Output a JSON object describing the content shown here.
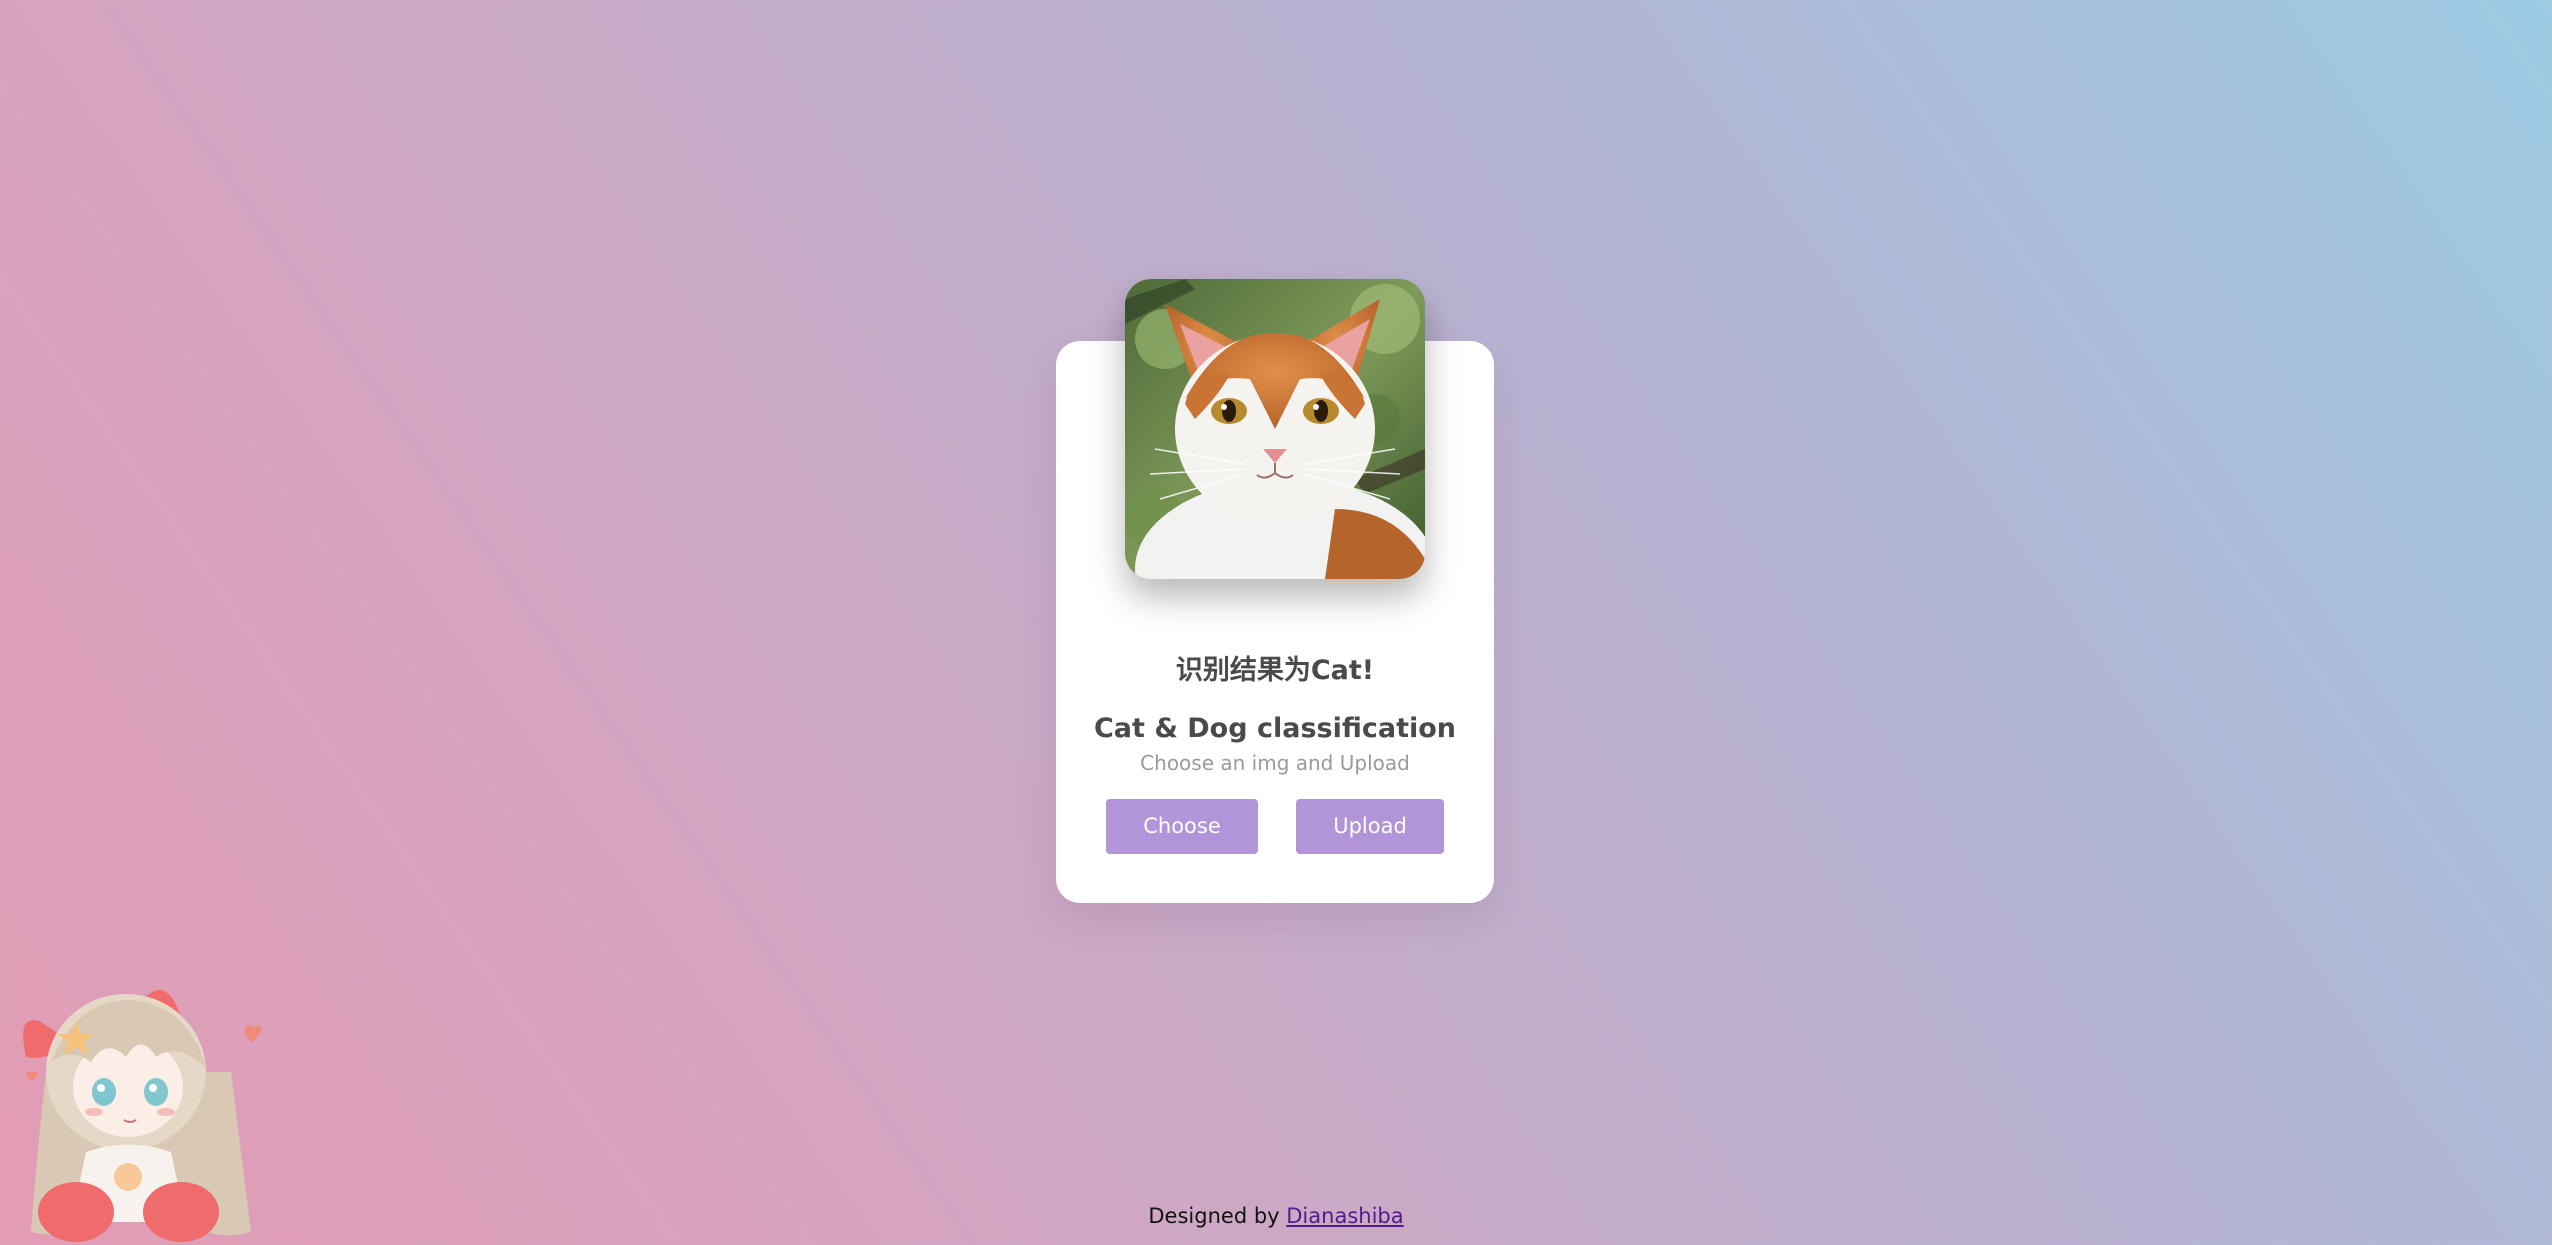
{
  "card": {
    "result_text": "识别结果为Cat!",
    "title": "Cat & Dog classification",
    "subtitle": "Choose an img and Upload",
    "choose_label": "Choose",
    "upload_label": "Upload"
  },
  "footer": {
    "prefix": "Designed by ",
    "author_link": "Dianashiba"
  },
  "colors": {
    "button": "#b295d9",
    "gradient_left": "#e39cb4",
    "gradient_right": "#9ccbe3"
  },
  "icons": {
    "photo": "cat-photo",
    "mascot": "anime-girl-mascot"
  }
}
